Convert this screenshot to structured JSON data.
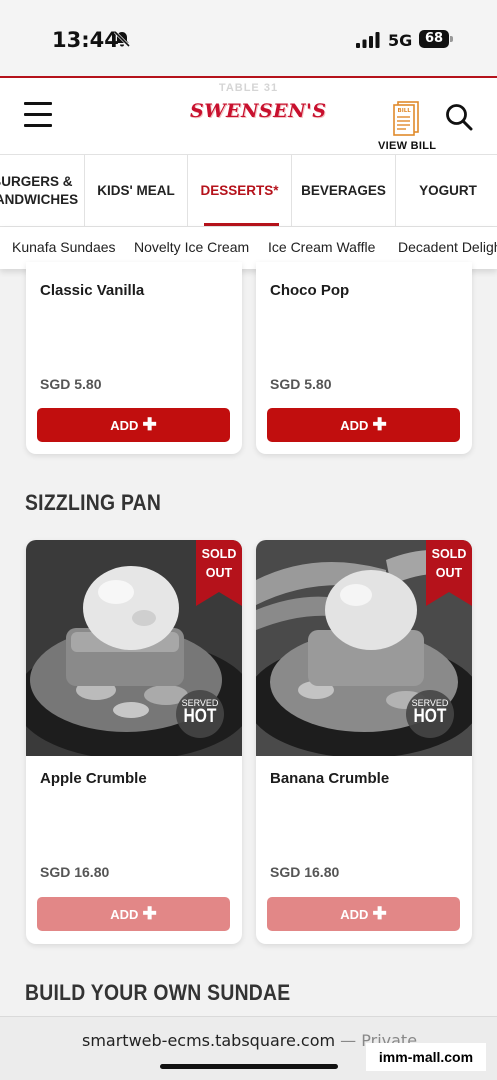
{
  "status_bar": {
    "time": "13:44",
    "network": "5G",
    "battery": "68"
  },
  "header": {
    "table_label": "TABLE 31",
    "logo_text": "SWENSEN'S",
    "view_bill_label": "VIEW BILL"
  },
  "categories": [
    {
      "label": "BURGERS &\nSANDWICHES",
      "active": false
    },
    {
      "label": "KIDS' MEAL",
      "active": false
    },
    {
      "label": "DESSERTS*",
      "active": true
    },
    {
      "label": "BEVERAGES",
      "active": false
    },
    {
      "label": "YOGURT",
      "active": false
    }
  ],
  "subcategories": [
    "Kunafa Sundaes",
    "Novelty Ice Cream",
    "Ice Cream Waffle",
    "Decadent Delight"
  ],
  "top_items": [
    {
      "name": "Classic Vanilla",
      "price": "SGD 5.80",
      "add_label": "ADD"
    },
    {
      "name": "Choco Pop",
      "price": "SGD 5.80",
      "add_label": "ADD"
    }
  ],
  "sections": [
    {
      "title": "SIZZLING PAN",
      "items": [
        {
          "name": "Apple Crumble",
          "price": "SGD 16.80",
          "add_label": "ADD",
          "badge_line1": "SOLD",
          "badge_line2": "OUT",
          "served_small": "SERVED",
          "served_big": "HOT"
        },
        {
          "name": "Banana Crumble",
          "price": "SGD 16.80",
          "add_label": "ADD",
          "badge_line1": "SOLD",
          "badge_line2": "OUT",
          "served_small": "SERVED",
          "served_big": "HOT"
        }
      ]
    },
    {
      "title": "BUILD YOUR OWN SUNDAE"
    }
  ],
  "browser": {
    "url": "smartweb-ecms.tabsquare.com",
    "separator": " — ",
    "mode": "Private"
  },
  "watermark": "imm-mall.com",
  "colors": {
    "brand_red": "#b5121b",
    "add_active": "#c10e0e",
    "add_disabled": "#e28787"
  }
}
